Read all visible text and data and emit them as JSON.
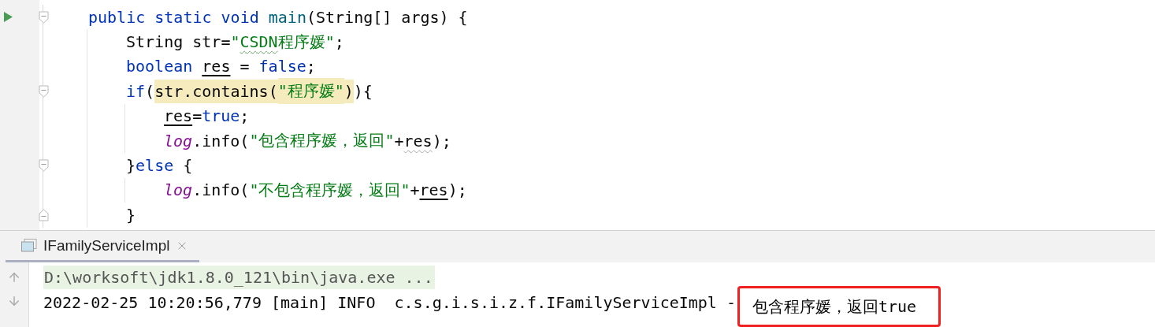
{
  "editor": {
    "lines": [
      {
        "run": true,
        "expanded": true,
        "tokens": [
          {
            "text": "public static void ",
            "kind": "keyword"
          },
          {
            "text": "main",
            "kind": "method"
          },
          {
            "text": "(String[] args) {",
            "kind": "plain"
          }
        ],
        "children": [
          {
            "tokens": [
              {
                "text": "String str=",
                "kind": "plain"
              },
              {
                "text": "\"",
                "kind": "string"
              },
              {
                "text": "CSDN",
                "kind": "string",
                "wavy": true
              },
              {
                "text": "程序媛\"",
                "kind": "string"
              },
              {
                "text": ";",
                "kind": "plain"
              }
            ]
          },
          {
            "tokens": [
              {
                "text": "boolean ",
                "kind": "keyword"
              },
              {
                "text": "res",
                "kind": "local"
              },
              {
                "text": " = ",
                "kind": "plain"
              },
              {
                "text": "false",
                "kind": "keyword"
              },
              {
                "text": ";",
                "kind": "plain"
              }
            ]
          },
          {
            "expanded": true,
            "tokens": [
              {
                "text": "if",
                "kind": "keyword"
              },
              {
                "text": "(",
                "kind": "plain"
              },
              {
                "text": "str.contains(",
                "kind": "plain",
                "highlight": true
              },
              {
                "text": "\"程序媛\"",
                "kind": "string",
                "highlight": true
              },
              {
                "text": ")",
                "kind": "plain",
                "highlight": true
              },
              {
                "text": "){",
                "kind": "plain"
              }
            ],
            "children": [
              {
                "tokens": [
                  {
                    "text": "res",
                    "kind": "local"
                  },
                  {
                    "text": "=",
                    "kind": "plain"
                  },
                  {
                    "text": "true",
                    "kind": "keyword"
                  },
                  {
                    "text": ";",
                    "kind": "plain"
                  }
                ]
              },
              {
                "tokens": [
                  {
                    "text": "log",
                    "kind": "static"
                  },
                  {
                    "text": ".info(",
                    "kind": "plain"
                  },
                  {
                    "text": "\"包含程序媛，返回\"",
                    "kind": "string"
                  },
                  {
                    "text": "+",
                    "kind": "plain"
                  },
                  {
                    "text": "res",
                    "kind": "plain",
                    "wavy": true
                  },
                  {
                    "text": ");",
                    "kind": "plain"
                  }
                ]
              }
            ]
          },
          {
            "expanded": true,
            "tokens": [
              {
                "text": "}",
                "kind": "plain"
              },
              {
                "text": "else",
                "kind": "keyword"
              },
              {
                "text": " {",
                "kind": "plain"
              }
            ],
            "children": [
              {
                "tokens": [
                  {
                    "text": "log",
                    "kind": "static"
                  },
                  {
                    "text": ".info(",
                    "kind": "plain"
                  },
                  {
                    "text": "\"不包含程序媛，返回\"",
                    "kind": "string"
                  },
                  {
                    "text": "+",
                    "kind": "plain"
                  },
                  {
                    "text": "res",
                    "kind": "local"
                  },
                  {
                    "text": ");",
                    "kind": "plain"
                  }
                ]
              }
            ]
          },
          {
            "fold_end": true,
            "tokens": [
              {
                "text": "}",
                "kind": "plain"
              }
            ]
          }
        ]
      }
    ]
  },
  "run_panel": {
    "tabs": [
      {
        "label": "IFamilyServiceImpl",
        "selected": true
      }
    ],
    "console": [
      {
        "kind": "command",
        "text": "D:\\worksoft\\jdk1.8.0_121\\bin\\java.exe ..."
      },
      {
        "kind": "log",
        "text": "2022-02-25 10:20:56,779 [main] INFO  c.s.g.i.s.i.z.f.IFamilyServiceImpl -",
        "message": "包含程序媛，返回true",
        "boxed": true
      }
    ]
  }
}
